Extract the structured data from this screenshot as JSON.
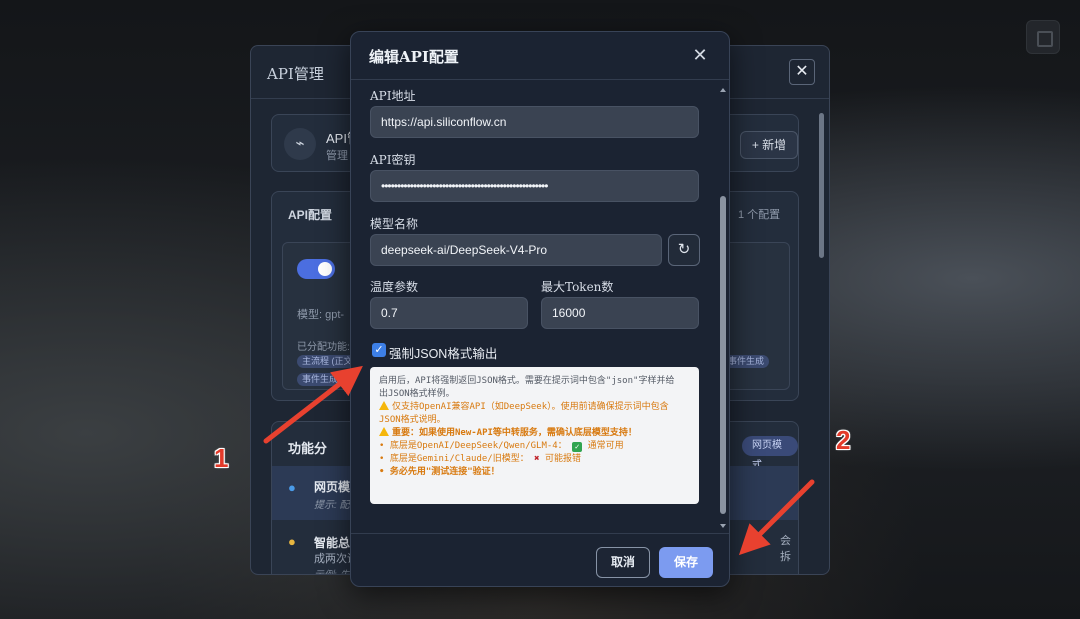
{
  "background": {
    "panel": {
      "title": "API管理",
      "close_label": "✕",
      "card1": {
        "title": "API管",
        "subtitle": "管理",
        "add_label": "+ 新增"
      },
      "card2": {
        "title": "API配置",
        "count": "1 个配置",
        "model_label": "模型: gpt-",
        "functions_label": "已分配功能:",
        "tags": [
          "主流程 (正文",
          "事件生成",
          "事件生成"
        ]
      },
      "card3": {
        "title": "功能分",
        "mode_tag": "网页模式",
        "row1_title": "网页模",
        "row1_hint": "提示: 配",
        "row2_title": "智能总",
        "row2_desc": "成两次调",
        "row2_example": "示例: 先",
        "trail_text": "会拆"
      }
    }
  },
  "modal": {
    "title": "编辑API配置",
    "close_label": "✕",
    "fields": {
      "api_url": {
        "label": "API地址",
        "value": "https://api.siliconflow.cn"
      },
      "api_key": {
        "label": "API密钥",
        "value": "••••••••••••••••••••••••••••••••••••••••••••••••••••"
      },
      "model_name": {
        "label": "模型名称",
        "value": "deepseek-ai/DeepSeek-V4-Pro"
      },
      "temperature": {
        "label": "温度参数",
        "value": "0.7"
      },
      "max_tokens": {
        "label": "最大Token数",
        "value": "16000"
      }
    },
    "json_checkbox": {
      "label": "强制JSON格式输出",
      "checked": true
    },
    "notice": {
      "line1": "启用后，API将强制返回JSON格式。需要在提示词中包含\"json\"字样并给",
      "line2": "出JSON格式样例。",
      "line3": "仅支持OpenAI兼容API（如DeepSeek）。使用前请确保提示词中包含",
      "line4": "JSON格式说明。",
      "line5": "重要：如果使用New-API等中转服务，需确认底层模型支持！",
      "line6a": "• 底层是OpenAI/DeepSeek/Qwen/GLM-4：",
      "line6b": "通常可用",
      "line7a": "• 底层是Gemini/Claude/旧模型：",
      "line7b": "可能报错",
      "line8": "• 务必先用\"测试连接\"验证！"
    },
    "buttons": {
      "cancel": "取消",
      "save": "保存"
    }
  },
  "annotations": {
    "marker1": "1",
    "marker2": "2"
  },
  "colors": {
    "accent": "#7c9bf0",
    "checkbox": "#3d7fe6",
    "annotation": "#e33a2a",
    "warning": "#d87a10"
  }
}
